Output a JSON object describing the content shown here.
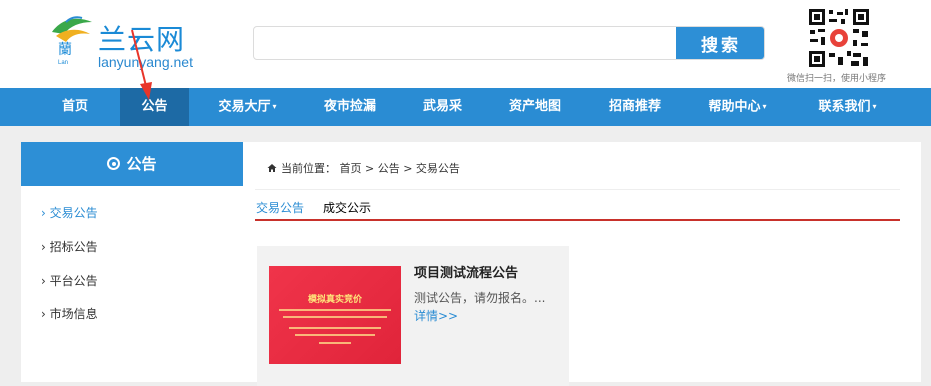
{
  "header": {
    "logo_title": "兰云网",
    "logo_sub": "lanyunyang.net",
    "search_placeholder": "",
    "search_label": "搜索",
    "qr_caption": "微信扫一扫，使用小程序"
  },
  "nav": {
    "items": [
      {
        "label": "首页",
        "dropdown": false
      },
      {
        "label": "公告",
        "dropdown": false,
        "active": true
      },
      {
        "label": "交易大厅",
        "dropdown": true
      },
      {
        "label": "夜市捡漏",
        "dropdown": false
      },
      {
        "label": "武易采",
        "dropdown": false
      },
      {
        "label": "资产地图",
        "dropdown": false
      },
      {
        "label": "招商推荐",
        "dropdown": false
      },
      {
        "label": "帮助中心",
        "dropdown": true
      },
      {
        "label": "联系我们",
        "dropdown": true
      }
    ],
    "caret": "▾"
  },
  "sidebar": {
    "title": "公告",
    "items": [
      {
        "label": "› 交易公告",
        "active": true
      },
      {
        "label": "› 招标公告"
      },
      {
        "label": "› 平台公告"
      },
      {
        "label": "› 市场信息"
      }
    ]
  },
  "breadcrumb": {
    "icon": "home-icon",
    "text": "当前位置： 首页 > 公告 > 交易公告"
  },
  "tabs": [
    {
      "label": "交易公告",
      "active": true
    },
    {
      "label": "成交公示"
    }
  ],
  "listing": {
    "thumb_title": "模拟真实竞价",
    "title": "项目测试流程公告",
    "description": "测试公告，请勿报名。...",
    "more": "详情>>"
  },
  "colors": {
    "primary": "#2a8cd3",
    "nav_active": "#1d6aa5",
    "tab_underline": "#c8312b",
    "thumb": "#ee3347"
  }
}
